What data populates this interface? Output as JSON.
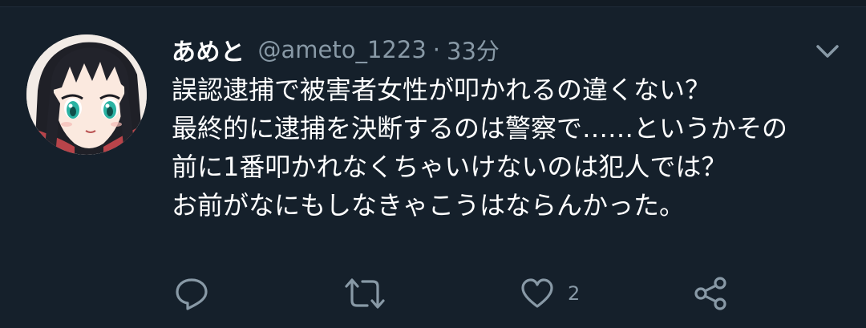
{
  "tweet": {
    "display_name": "あめと",
    "handle": "@ameto_1223",
    "separator": "·",
    "time": "33分",
    "text_lines": [
      "誤認逮捕で被害者女性が叩かれるの違くない？",
      "最終的に逮捕を決断するのは警察で……というかその",
      "前に1番叩かれなくちゃいけないのは犯人では？",
      "お前がなにもしなきゃこうはならんかった。"
    ]
  },
  "actions": {
    "reply_icon": "reply-icon",
    "retweet_icon": "retweet-icon",
    "like_icon": "heart-icon",
    "like_count": "2",
    "share_icon": "share-icon"
  },
  "colors": {
    "background": "#15202b",
    "primary_text": "#ffffff",
    "secondary_text": "#8899a6"
  }
}
